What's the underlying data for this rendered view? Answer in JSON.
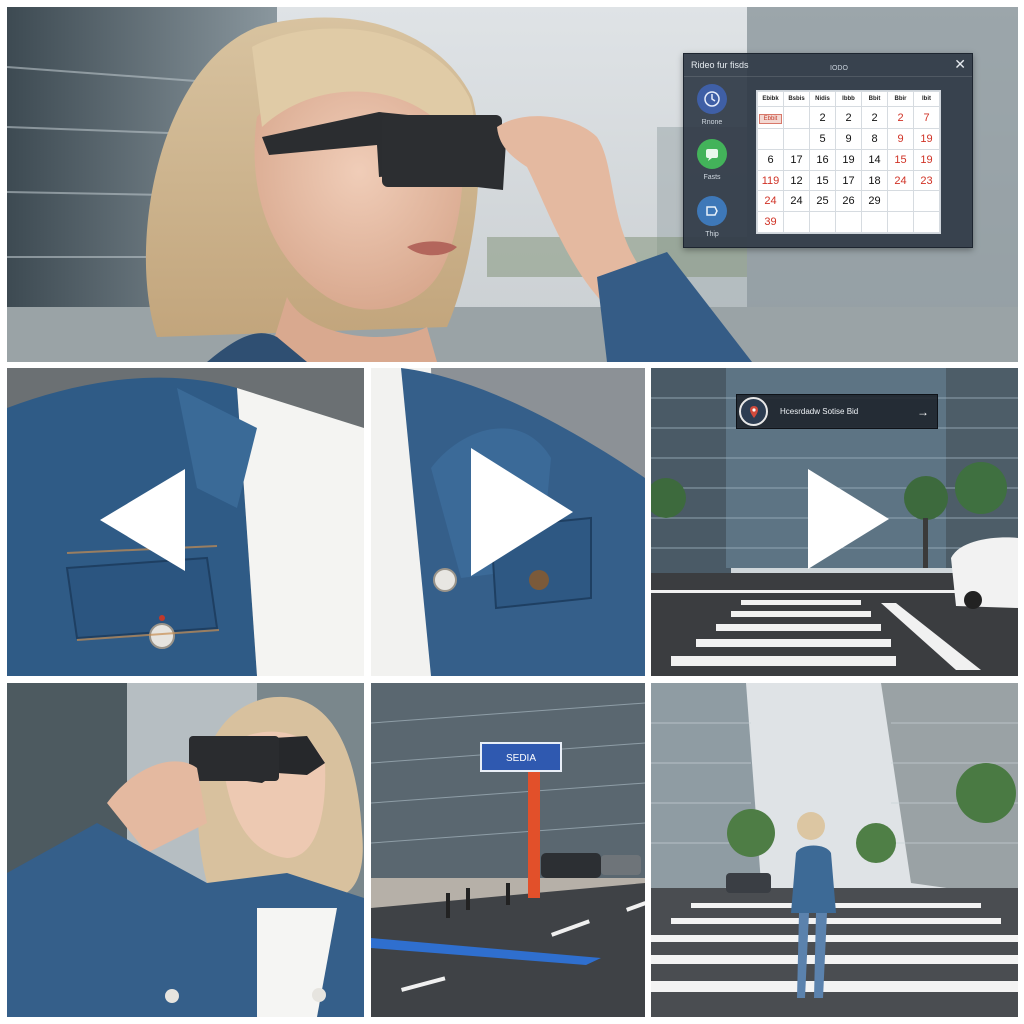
{
  "ar_calendar": {
    "title": "Rideo fur fisds",
    "center_label": "IODO",
    "close_symbol": "✕",
    "apps": [
      {
        "icon": "clock-icon",
        "label": "Rnone",
        "color": "#3f5fa6"
      },
      {
        "icon": "chat-icon",
        "label": "Fasts",
        "color": "#43b35a"
      },
      {
        "icon": "map-icon",
        "label": "Thip",
        "color": "#3e78b8"
      }
    ],
    "weekdays": [
      "Ebibk",
      "Bsbis",
      "Nidis",
      "Ibbb",
      "Bbit",
      "Bbir",
      "Ibit"
    ],
    "rows": [
      [
        {
          "t": "Ebbit",
          "badge": true
        },
        {
          "t": ""
        },
        {
          "t": "2"
        },
        {
          "t": "2"
        },
        {
          "t": "2"
        },
        {
          "t": "2",
          "red": true
        },
        {
          "t": "7",
          "red": true
        }
      ],
      [
        {
          "t": ""
        },
        {
          "t": ""
        },
        {
          "t": "5"
        },
        {
          "t": "9"
        },
        {
          "t": "8"
        },
        {
          "t": "9",
          "red": true
        },
        {
          "t": "19",
          "red": true
        }
      ],
      [
        {
          "t": "6"
        },
        {
          "t": "17"
        },
        {
          "t": "16"
        },
        {
          "t": "19"
        },
        {
          "t": "14"
        },
        {
          "t": "15",
          "red": true
        },
        {
          "t": "19",
          "red": true
        }
      ],
      [
        {
          "t": "119",
          "red": true
        },
        {
          "t": "12"
        },
        {
          "t": "15"
        },
        {
          "t": "17"
        },
        {
          "t": "18"
        },
        {
          "t": "24",
          "red": true
        },
        {
          "t": "23",
          "red": true
        }
      ],
      [
        {
          "t": "24",
          "red": true
        },
        {
          "t": "24"
        },
        {
          "t": "25"
        },
        {
          "t": "26"
        },
        {
          "t": "29"
        },
        {
          "t": ""
        },
        {
          "t": ""
        }
      ],
      [
        {
          "t": "39",
          "red": true
        },
        {
          "t": ""
        },
        {
          "t": ""
        },
        {
          "t": ""
        },
        {
          "t": ""
        },
        {
          "t": ""
        },
        {
          "t": ""
        }
      ]
    ]
  },
  "nav_card": {
    "text": "Hcesrdadw Sotise Bid",
    "arrow": "→",
    "icon": "location-pin-icon"
  },
  "street_sign": {
    "text": "SEDIA"
  },
  "controls": {
    "previous": "previous-arrow",
    "play_1": "play-arrow",
    "play_2": "play-arrow"
  }
}
